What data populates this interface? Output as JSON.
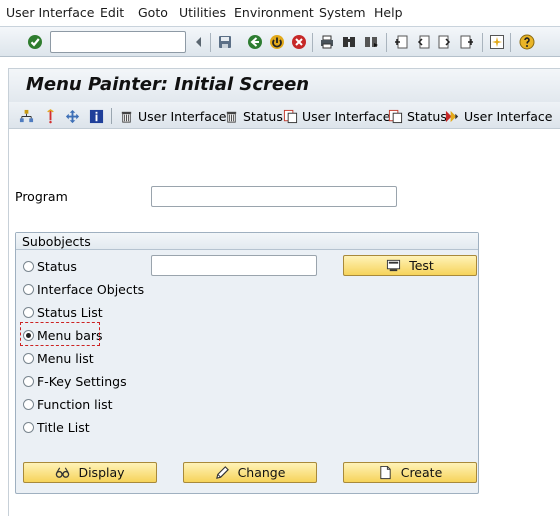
{
  "menu": {
    "items": [
      "User Interface",
      "Edit",
      "Goto",
      "Utilities",
      "Environment",
      "System",
      "Help"
    ]
  },
  "system_toolbar": {
    "command_field_value": "",
    "icons": [
      "enter-checkmark-icon",
      "history-arrow-icon",
      "save-icon",
      "back-icon",
      "exit-icon",
      "cancel-icon",
      "print-icon",
      "find-icon",
      "find-next-icon",
      "first-page-icon",
      "previous-page-icon",
      "next-page-icon",
      "last-page-icon",
      "create-session-icon",
      "help-icon"
    ]
  },
  "page": {
    "title": "Menu Painter: Initial Screen"
  },
  "app_toolbar": {
    "icons": [
      "hierarchy-icon",
      "where-used-icon",
      "navigate-icon",
      "info-icon"
    ],
    "delete_user_interface": "User Interface",
    "delete_status": "Status",
    "copy_user_interface": "User Interface",
    "copy_status": "Status",
    "rename_user_interface": "User Interface"
  },
  "form": {
    "program_label": "Program",
    "program_value": ""
  },
  "subobjects": {
    "title": "Subobjects",
    "status_field_value": "",
    "test_button": "Test",
    "options": [
      {
        "label": "Status",
        "checked": false
      },
      {
        "label": "Interface Objects",
        "checked": false
      },
      {
        "label": "Status List",
        "checked": false
      },
      {
        "label": "Menu bars",
        "checked": true
      },
      {
        "label": "Menu list",
        "checked": false
      },
      {
        "label": "F-Key Settings",
        "checked": false
      },
      {
        "label": "Function list",
        "checked": false
      },
      {
        "label": "Title List",
        "checked": false
      }
    ],
    "display_button": "Display",
    "change_button": "Change",
    "create_button": "Create"
  },
  "colors": {
    "button_yellow": "#f6d35b",
    "group_background": "#ebf0f5",
    "focus_red": "#cc2222"
  }
}
